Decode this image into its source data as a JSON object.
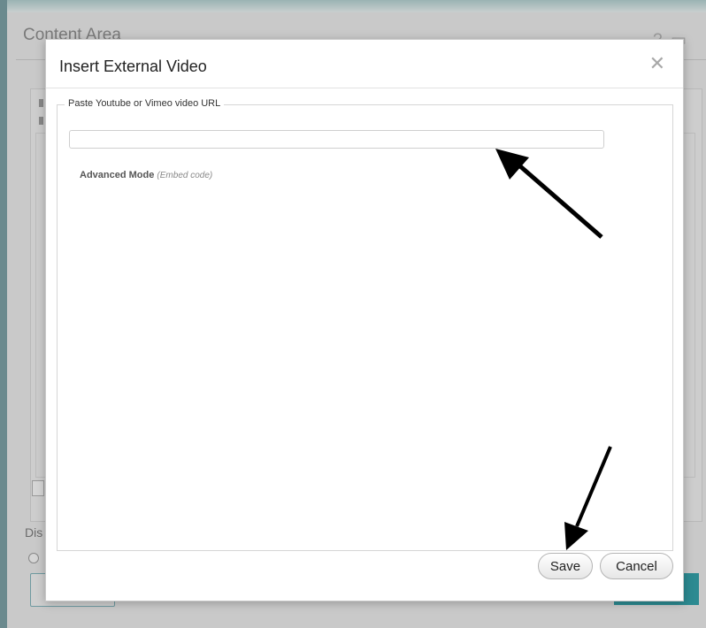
{
  "underlay": {
    "title": "Content Area",
    "controls": "? ▭ ✕",
    "label": "Dis"
  },
  "dialog": {
    "title": "Insert External Video",
    "close_icon": "close-icon",
    "fieldset_legend": "Paste Youtube or Vimeo video URL",
    "url_input": {
      "value": "",
      "placeholder": ""
    },
    "advanced_label": "Advanced Mode",
    "advanced_hint": "(Embed code)",
    "save_label": "Save",
    "cancel_label": "Cancel"
  },
  "annotations": {
    "arrow_color": "#000000",
    "arrow_targets": [
      "url-input",
      "save-button"
    ]
  }
}
